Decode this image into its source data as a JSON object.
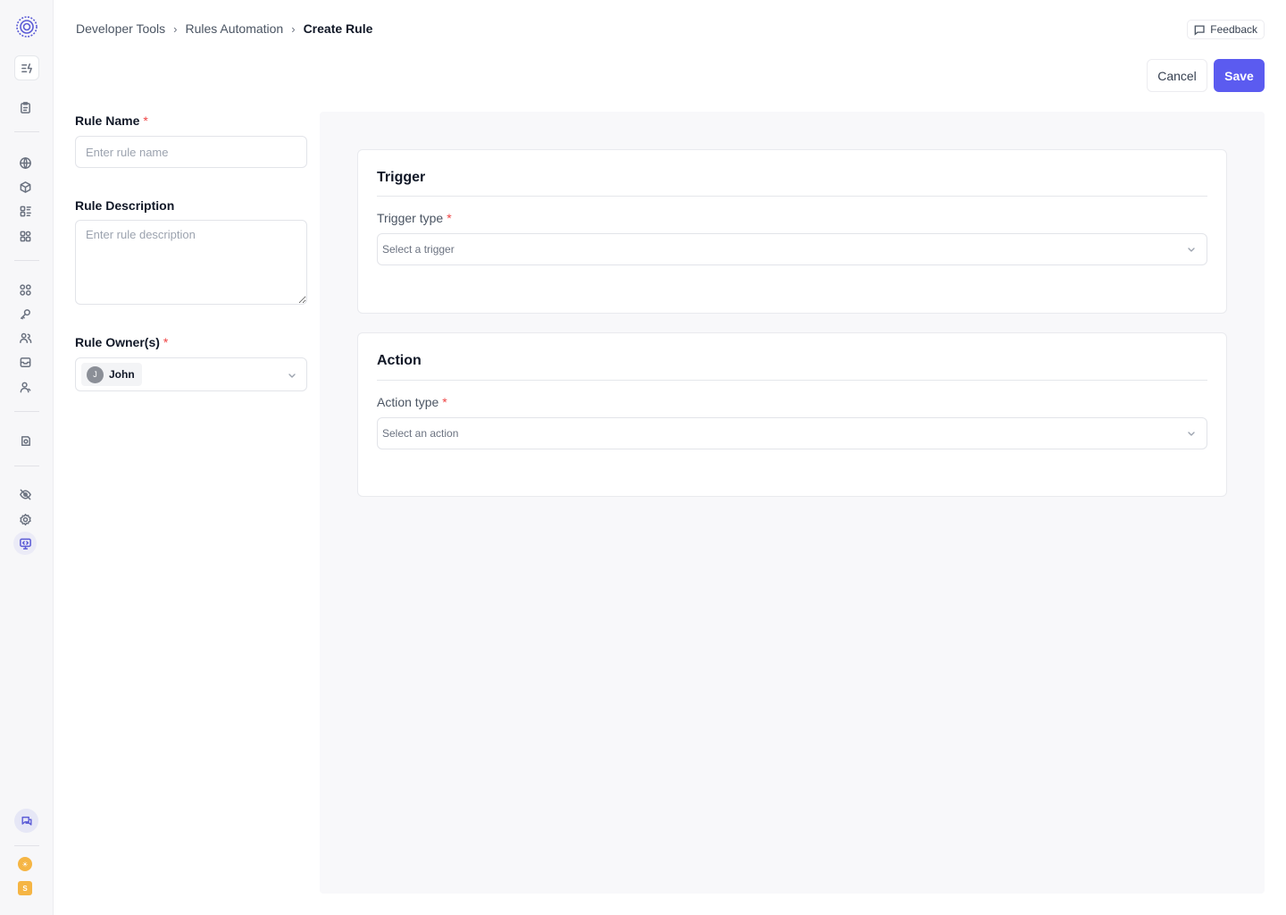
{
  "breadcrumb": {
    "items": [
      "Developer Tools",
      "Rules Automation"
    ],
    "current": "Create Rule"
  },
  "header": {
    "feedback_label": "Feedback",
    "cancel_label": "Cancel",
    "save_label": "Save"
  },
  "form": {
    "rule_name": {
      "label": "Rule Name",
      "required": "*",
      "placeholder": "Enter rule name"
    },
    "rule_description": {
      "label": "Rule Description",
      "placeholder": "Enter rule description"
    },
    "rule_owners": {
      "label": "Rule Owner(s)",
      "required": "*",
      "selected": {
        "initial": "J",
        "name": "John"
      }
    }
  },
  "trigger": {
    "title": "Trigger",
    "label": "Trigger type",
    "required": "*",
    "placeholder": "Select a trigger"
  },
  "action": {
    "title": "Action",
    "label": "Action type",
    "required": "*",
    "placeholder": "Select an action"
  },
  "sidebar": {
    "org_initial": "☀",
    "user_initial": "S"
  },
  "colors": {
    "accent": "#5b5bf0",
    "required": "#ef4444",
    "avatar": "#f5b544"
  }
}
